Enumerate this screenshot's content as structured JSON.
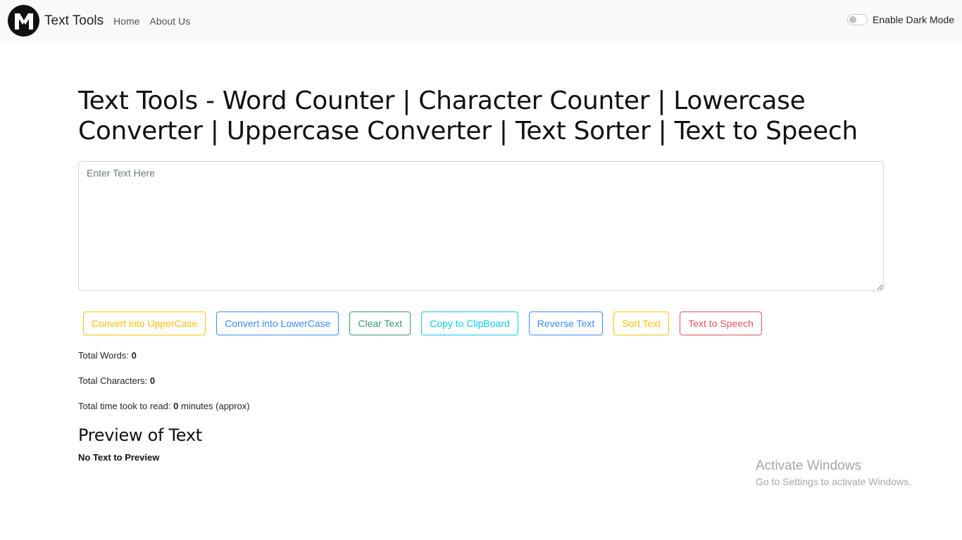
{
  "navbar": {
    "brand": "Text Tools",
    "links": [
      "Home",
      "About Us"
    ],
    "dark_mode_label": "Enable Dark Mode",
    "dark_mode_enabled": false
  },
  "main": {
    "title": "Text Tools - Word Counter | Character Counter | Lowercase Converter | Uppercase Converter | Text Sorter | Text to Speech",
    "textarea": {
      "placeholder": "Enter Text Here",
      "value": ""
    },
    "buttons": [
      {
        "label": "Convert into UpperCase",
        "style": "warning"
      },
      {
        "label": "Convert into LowerCase",
        "style": "primary"
      },
      {
        "label": "Clear Text",
        "style": "success"
      },
      {
        "label": "Copy to ClipBoard",
        "style": "info"
      },
      {
        "label": "Reverse Text",
        "style": "primary"
      },
      {
        "label": "Sort Text",
        "style": "warning"
      },
      {
        "label": "Text to Speech",
        "style": "danger"
      }
    ],
    "stats": {
      "words_label": "Total Words:",
      "words_value": "0",
      "chars_label": "Total Characters:",
      "chars_value": "0",
      "read_label": "Total time took to read:",
      "read_value": "0",
      "read_suffix": "minutes (approx)"
    },
    "preview": {
      "title": "Preview of Text",
      "text": "No Text to Preview"
    }
  },
  "watermark": {
    "title": "Activate Windows",
    "subtitle": "Go to Settings to activate Windows."
  },
  "colors": {
    "navbar_bg": "#f8f9fa",
    "warning": "#ffc107",
    "primary": "#0d6efd",
    "success": "#198754",
    "info": "#0dcaf0",
    "danger": "#dc3545"
  }
}
